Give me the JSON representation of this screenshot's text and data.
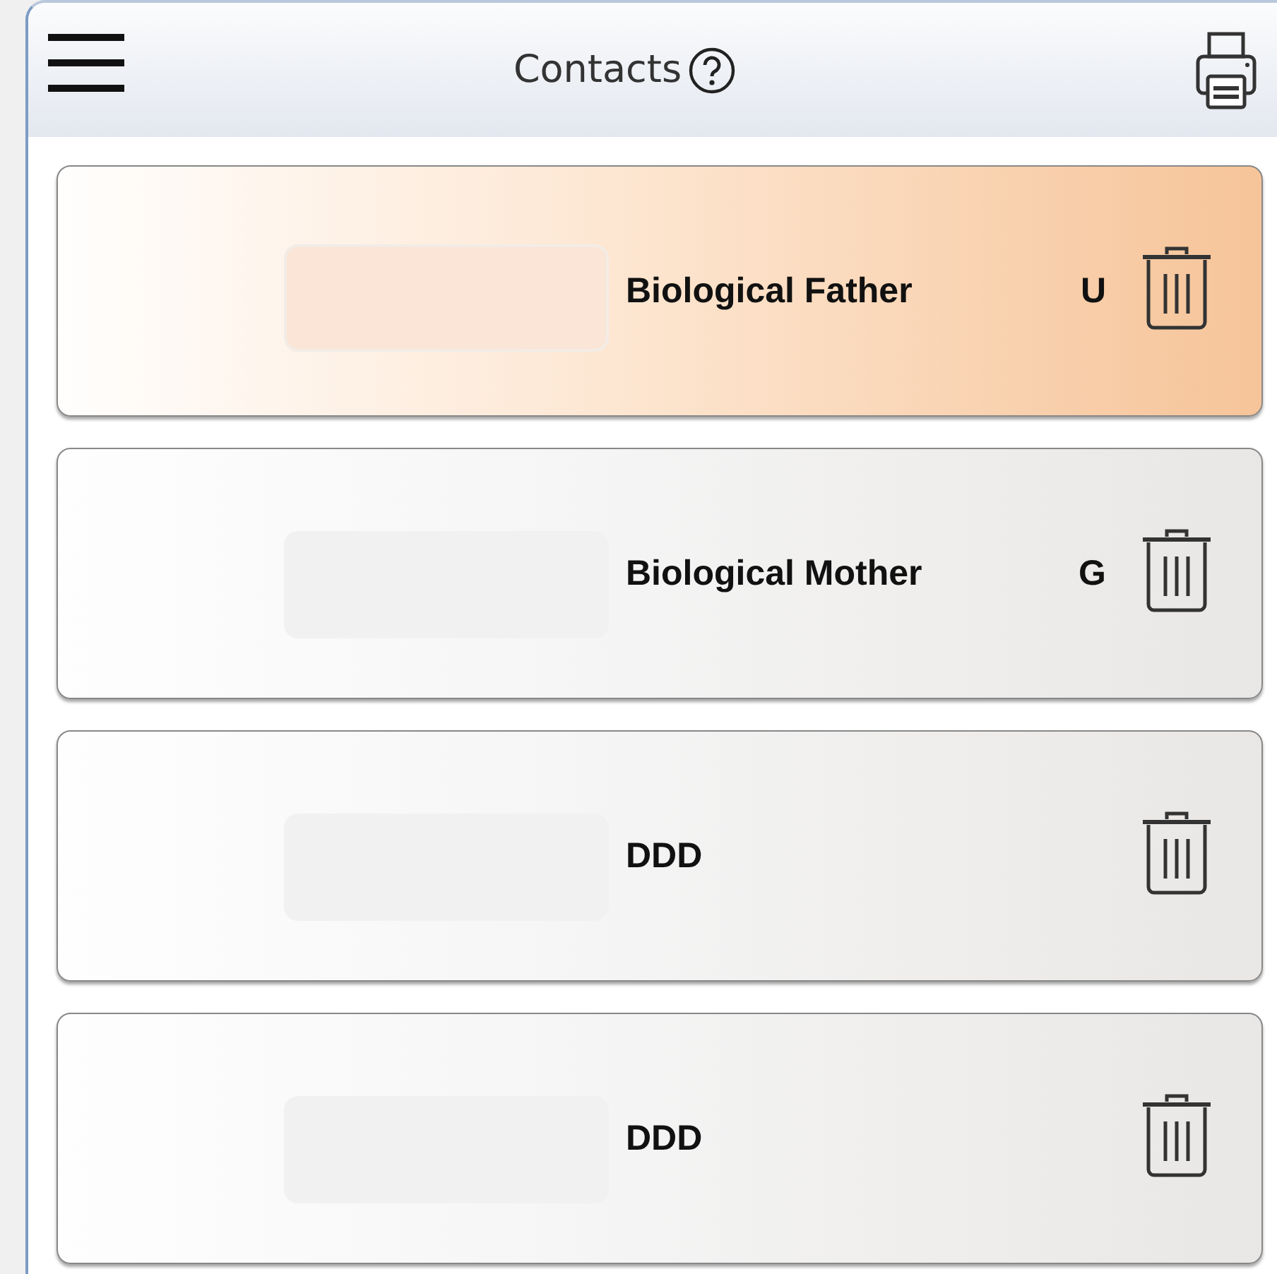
{
  "header": {
    "title": "Contacts"
  },
  "contacts": [
    {
      "name": "Biological Father",
      "code": "U",
      "selected": true
    },
    {
      "name": "Biological Mother",
      "code": "G",
      "selected": false
    },
    {
      "name": "DDD",
      "selected": false
    },
    {
      "name": "DDD",
      "selected": false
    }
  ]
}
